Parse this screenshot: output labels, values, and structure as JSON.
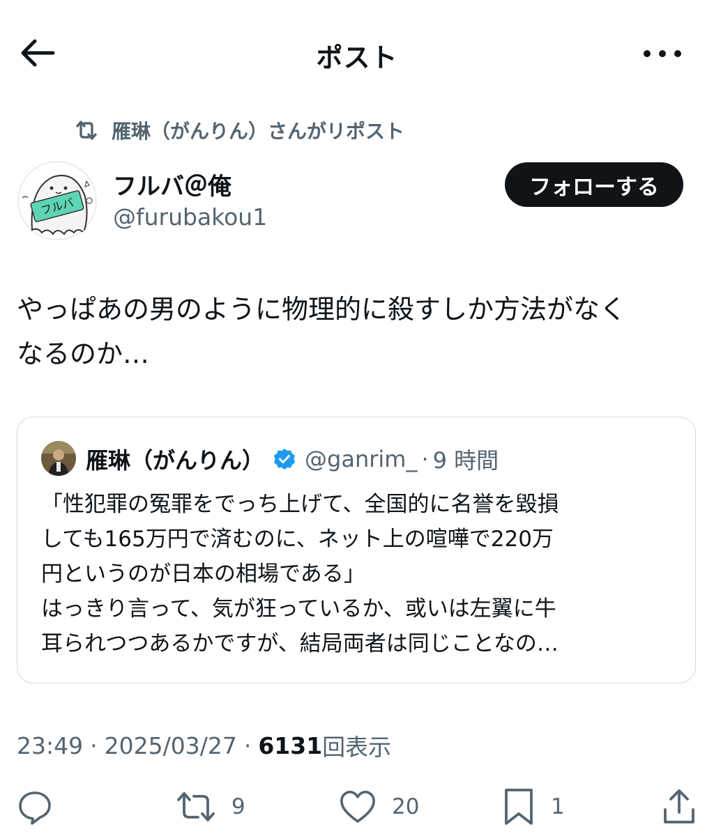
{
  "header": {
    "title": "ポスト"
  },
  "repost_context": {
    "text": "雁琳（がんりん）さんがリポスト"
  },
  "author": {
    "name": "フルバ＠俺",
    "handle": "@furubakou1",
    "avatar_text": "フルバ",
    "follow_label": "フォローする"
  },
  "post": {
    "text": "やっぱあの男のように物理的に殺すしか方法がなく\nなるのか…"
  },
  "quote": {
    "name": "雁琳（がんりん）",
    "handle": "@ganrim_",
    "dot": "·",
    "time": "9 時間",
    "text": "「性犯罪の冤罪をでっち上げて、全国的に名誉を毀損\nしても165万円で済むのに、ネット上の喧嘩で220万\n円というのが日本の相場である」\nはっきり言って、気が狂っているか、或いは左翼に牛\n耳られつつあるかですが、結局両者は同じことなの…"
  },
  "meta": {
    "time": "23:49",
    "sep1": "·",
    "date": "2025/03/27",
    "sep2": "·",
    "views_count": "6131",
    "views_label": "回表示"
  },
  "actions": {
    "reply_count": "",
    "repost_count": "9",
    "like_count": "20",
    "bookmark_count": "1"
  },
  "colors": {
    "text_primary": "#0f1419",
    "text_secondary": "#536471",
    "border": "#cfd9de",
    "verified": "#1d9bf0",
    "avatar_badge": "#5fd4b4"
  }
}
